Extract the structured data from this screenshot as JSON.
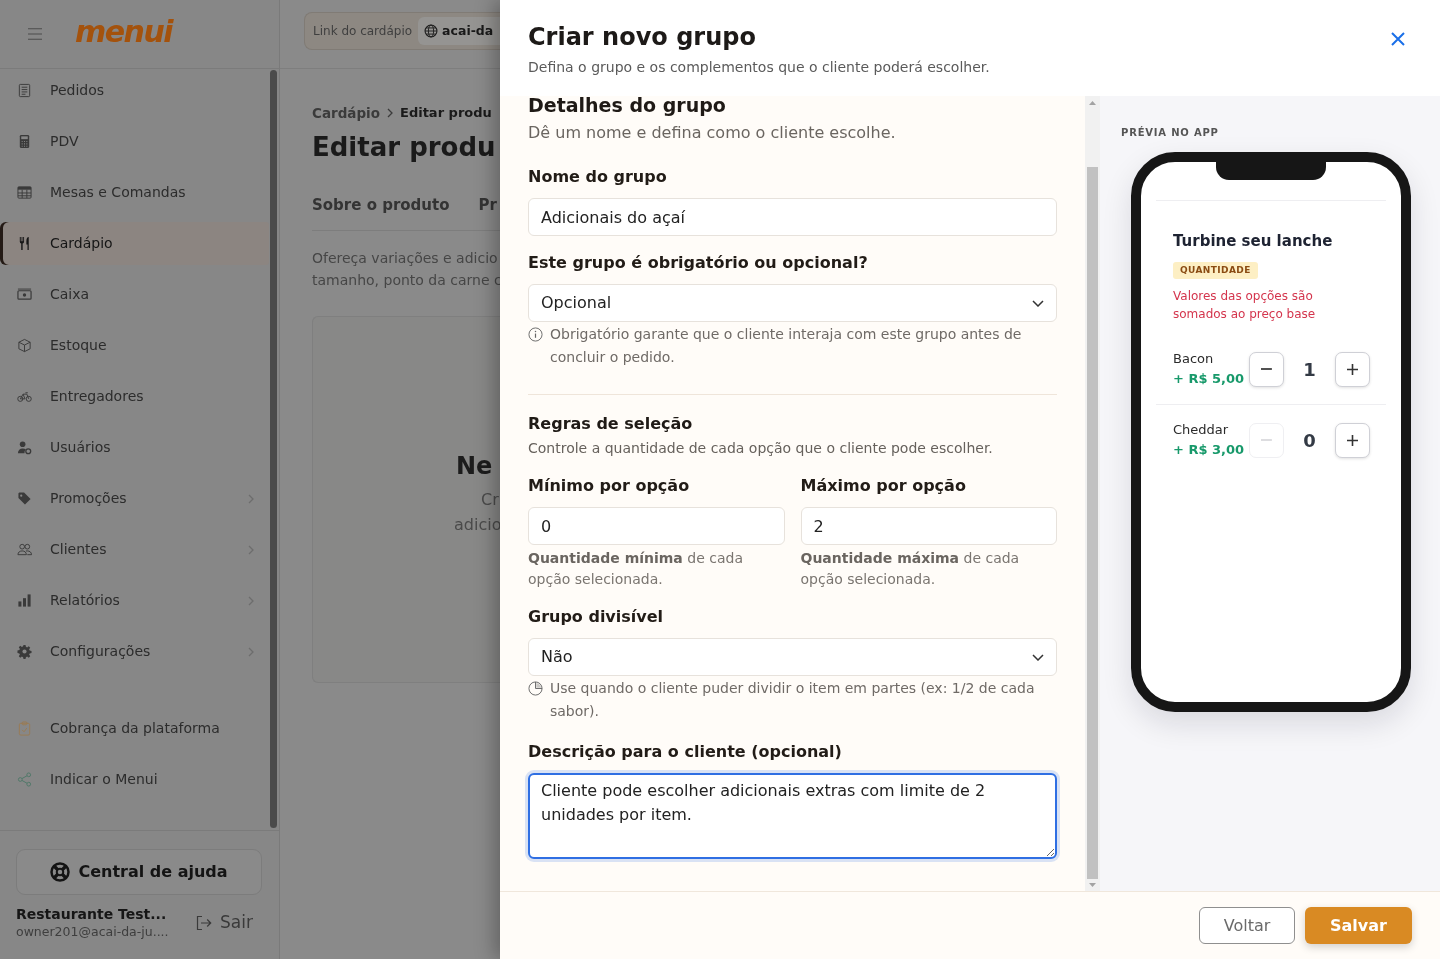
{
  "sidebar": {
    "brand": "menui",
    "items": [
      {
        "label": "Pedidos",
        "selected": false,
        "has_submenu": false
      },
      {
        "label": "PDV",
        "selected": false,
        "has_submenu": false
      },
      {
        "label": "Mesas e Comandas",
        "selected": false,
        "has_submenu": false
      },
      {
        "label": "Cardápio",
        "selected": true,
        "has_submenu": false
      },
      {
        "label": "Caixa",
        "selected": false,
        "has_submenu": false
      },
      {
        "label": "Estoque",
        "selected": false,
        "has_submenu": false
      },
      {
        "label": "Entregadores",
        "selected": false,
        "has_submenu": false
      },
      {
        "label": "Usuários",
        "selected": false,
        "has_submenu": false
      },
      {
        "label": "Promoções",
        "selected": false,
        "has_submenu": true
      },
      {
        "label": "Clientes",
        "selected": false,
        "has_submenu": true
      },
      {
        "label": "Relatórios",
        "selected": false,
        "has_submenu": true
      },
      {
        "label": "Configurações",
        "selected": false,
        "has_submenu": true
      }
    ],
    "extra_items": [
      {
        "label": "Cobrança da plataforma",
        "selected": false
      },
      {
        "label": "Indicar o Menui",
        "selected": false
      }
    ],
    "help_button": "Central de ajuda",
    "account": {
      "name": "Restaurante Test...",
      "email": "owner201@acai-da-ju....",
      "logout": "Sair"
    }
  },
  "topbar": {
    "link_label": "Link do cardápio",
    "link_value": "acai-da"
  },
  "page": {
    "breadcrumb": [
      "Cardápio",
      "Editar produ"
    ],
    "title": "Editar produ",
    "tabs": [
      {
        "label": "Sobre o produto",
        "selected": false
      },
      {
        "label": "Pr",
        "selected": false
      }
    ],
    "intro_lines": [
      "Ofereça variações e adicio",
      "tamanho, ponto da carne c"
    ],
    "empty_state": {
      "title": "Ne",
      "lines": [
        "Cr",
        "adicio"
      ]
    }
  },
  "modal": {
    "title": "Criar novo grupo",
    "subtitle": "Defina o grupo e os complementos que o cliente poderá escolher.",
    "section": {
      "title": "Detalhes do grupo",
      "subtitle": "Dê um nome e defina como o cliente escolhe."
    },
    "name_field": {
      "label": "Nome do grupo",
      "value": "Adicionais do açaí",
      "focused": false
    },
    "required_field": {
      "label": "Este grupo é obrigatório ou opcional?",
      "value": "Opcional",
      "focused": false,
      "hint": "Obrigatório garante que o cliente interaja com este grupo antes de concluir o pedido."
    },
    "rules": {
      "title": "Regras de seleção",
      "subtitle": "Controle a quantidade de cada opção que o cliente pode escolher.",
      "fields": [
        {
          "label": "Mínimo por opção",
          "value": "0",
          "focused": false,
          "hint": "**Quantidade mínima** de cada opção selecionada."
        },
        {
          "label": "Máximo por opção",
          "value": "2",
          "focused": false,
          "hint": "**Quantidade máxima** de cada opção selecionada."
        }
      ]
    },
    "divisible_field": {
      "label": "Grupo divisível",
      "value": "Não",
      "focused": false,
      "hint": "Use quando o cliente puder dividir o item em partes (ex: 1/2 de cada sabor)."
    },
    "description_field": {
      "label": "Descrição para o cliente (opcional)",
      "value": "Cliente pode escolher adicionais extras com limite de 2 unidades por item.",
      "focused": true
    },
    "preview": {
      "label": "PRÉVIA NO APP",
      "group_title": "Turbine seu lanche",
      "badge": "QUANTIDADE",
      "note": "Valores das opções são somados ao preço base",
      "options": [
        {
          "name": "Bacon",
          "price": "+ R$ 5,00",
          "quantity": "1",
          "decrease_disabled": false
        },
        {
          "name": "Cheddar",
          "price": "+ R$ 3,00",
          "quantity": "0",
          "decrease_disabled": true
        }
      ]
    },
    "buttons": [
      {
        "label": "Voltar",
        "kind": "secondary"
      },
      {
        "label": "Salvar",
        "kind": "primary"
      }
    ]
  }
}
